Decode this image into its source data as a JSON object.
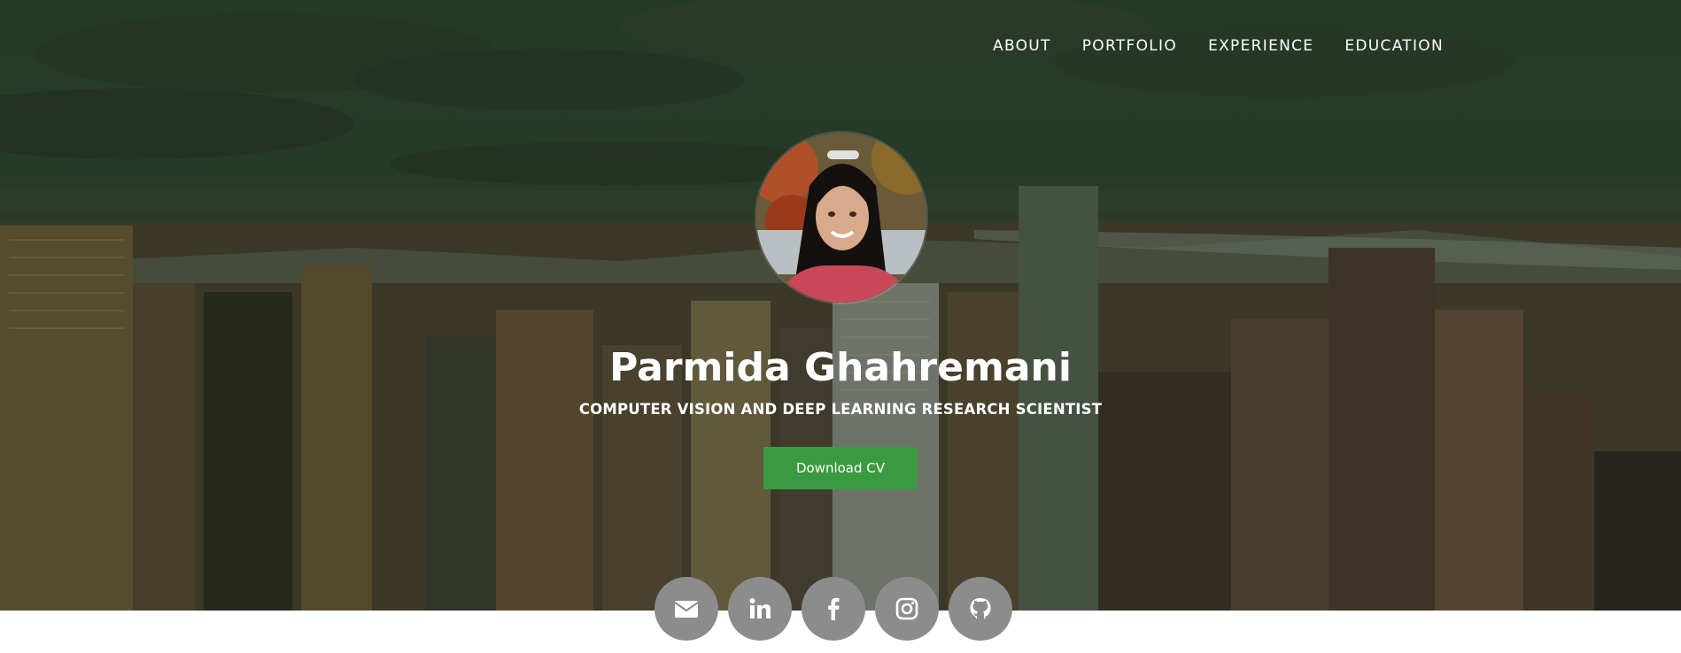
{
  "nav": {
    "items": [
      "ABOUT",
      "PORTFOLIO",
      "EXPERIENCE",
      "EDUCATION"
    ]
  },
  "profile": {
    "name": "Parmida Ghahremani",
    "subtitle": "COMPUTER VISION AND DEEP LEARNING RESEARCH SCIENTIST",
    "photo_alt": "Portrait photo"
  },
  "cta": {
    "download_label": "Download CV"
  },
  "socials": [
    {
      "icon": "envelope-icon"
    },
    {
      "icon": "linkedin-icon"
    },
    {
      "icon": "facebook-icon"
    },
    {
      "icon": "instagram-icon"
    },
    {
      "icon": "github-icon"
    }
  ],
  "colors": {
    "accent_green": "#3a9a3f",
    "social_gray": "#8c8c8c",
    "text": "#ffffff"
  }
}
